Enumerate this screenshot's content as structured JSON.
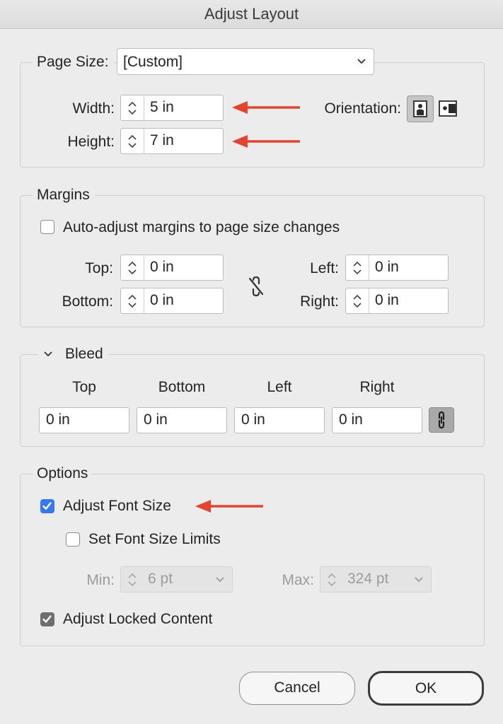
{
  "window": {
    "title": "Adjust Layout"
  },
  "page_size": {
    "label": "Page Size:",
    "value": "[Custom]",
    "width_label": "Width:",
    "width_value": "5 in",
    "height_label": "Height:",
    "height_value": "7 in",
    "orientation_label": "Orientation:",
    "orientation_selected": "portrait"
  },
  "margins": {
    "legend": "Margins",
    "auto_adjust_label": "Auto-adjust margins to page size changes",
    "auto_adjust_checked": false,
    "top_label": "Top:",
    "top_value": "0 in",
    "bottom_label": "Bottom:",
    "bottom_value": "0 in",
    "left_label": "Left:",
    "left_value": "0 in",
    "right_label": "Right:",
    "right_value": "0 in",
    "linked": false
  },
  "bleed": {
    "legend": "Bleed",
    "columns": [
      "Top",
      "Bottom",
      "Left",
      "Right"
    ],
    "values": [
      "0 in",
      "0 in",
      "0 in",
      "0 in"
    ],
    "linked": true
  },
  "options": {
    "legend": "Options",
    "adjust_font_size_label": "Adjust Font Size",
    "adjust_font_size_checked": true,
    "set_limits_label": "Set Font Size Limits",
    "set_limits_checked": false,
    "min_label": "Min:",
    "min_value": "6 pt",
    "max_label": "Max:",
    "max_value": "324 pt",
    "adjust_locked_label": "Adjust Locked Content",
    "adjust_locked_checked": true
  },
  "buttons": {
    "cancel": "Cancel",
    "ok": "OK"
  },
  "colors": {
    "accent": "#3478f6",
    "arrow": "#e5432d"
  }
}
